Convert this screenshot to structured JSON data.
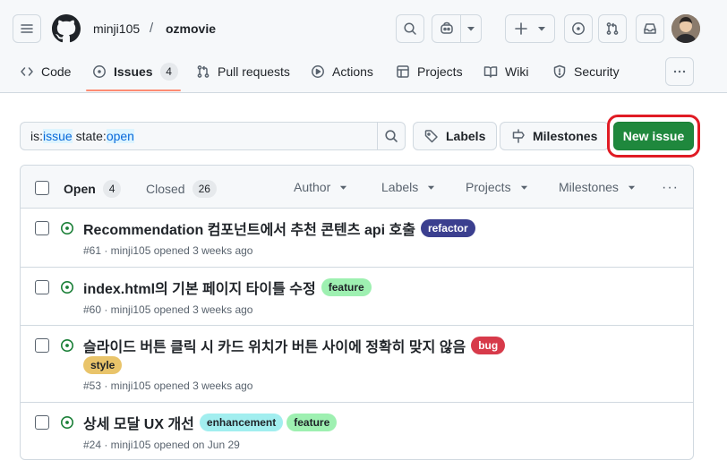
{
  "header": {
    "owner": "minji105",
    "separator": "/",
    "repo": "ozmovie"
  },
  "tabs": [
    {
      "label": "Code",
      "icon": "code-icon"
    },
    {
      "label": "Issues",
      "icon": "issue-opened-icon",
      "count": "4"
    },
    {
      "label": "Pull requests",
      "icon": "git-pull-request-icon"
    },
    {
      "label": "Actions",
      "icon": "play-icon"
    },
    {
      "label": "Projects",
      "icon": "table-icon"
    },
    {
      "label": "Wiki",
      "icon": "book-icon"
    },
    {
      "label": "Security",
      "icon": "shield-icon"
    }
  ],
  "filter": {
    "key1": "is:",
    "val1": "issue",
    "key2": " state:",
    "val2": "open"
  },
  "toolbar": {
    "labels": "Labels",
    "milestones": "Milestones",
    "new_issue": "New issue"
  },
  "list_header": {
    "open_label": "Open",
    "open_count": "4",
    "closed_label": "Closed",
    "closed_count": "26",
    "author": "Author",
    "labels": "Labels",
    "projects": "Projects",
    "milestones": "Milestones"
  },
  "issues": [
    {
      "title": "Recommendation 컴포넌트에서 추천 콘텐츠 api 호출",
      "labels": [
        {
          "name": "refactor",
          "bg": "#3b3f8f",
          "fg": "#ffffff"
        }
      ],
      "meta": "#61 · minji105 opened 3 weeks ago"
    },
    {
      "title": "index.html의 기본 페이지 타이틀 수정",
      "labels": [
        {
          "name": "feature",
          "bg": "#9ef0b1",
          "fg": "#1f2328"
        }
      ],
      "meta": "#60 · minji105 opened 3 weeks ago"
    },
    {
      "title": "슬라이드 버튼 클릭 시 카드 위치가 버튼 사이에 정확히 맞지 않음",
      "labels": [
        {
          "name": "bug",
          "bg": "#d73a4a",
          "fg": "#ffffff"
        },
        {
          "name": "style",
          "bg": "#e9c46a",
          "fg": "#1f2328"
        }
      ],
      "meta": "#53 · minji105 opened 3 weeks ago"
    },
    {
      "title": "상세 모달 UX 개선",
      "labels": [
        {
          "name": "enhancement",
          "bg": "#a2eeef",
          "fg": "#1f2328"
        },
        {
          "name": "feature",
          "bg": "#9ef0b1",
          "fg": "#1f2328"
        }
      ],
      "meta": "#24 · minji105 opened on Jun 29"
    }
  ]
}
